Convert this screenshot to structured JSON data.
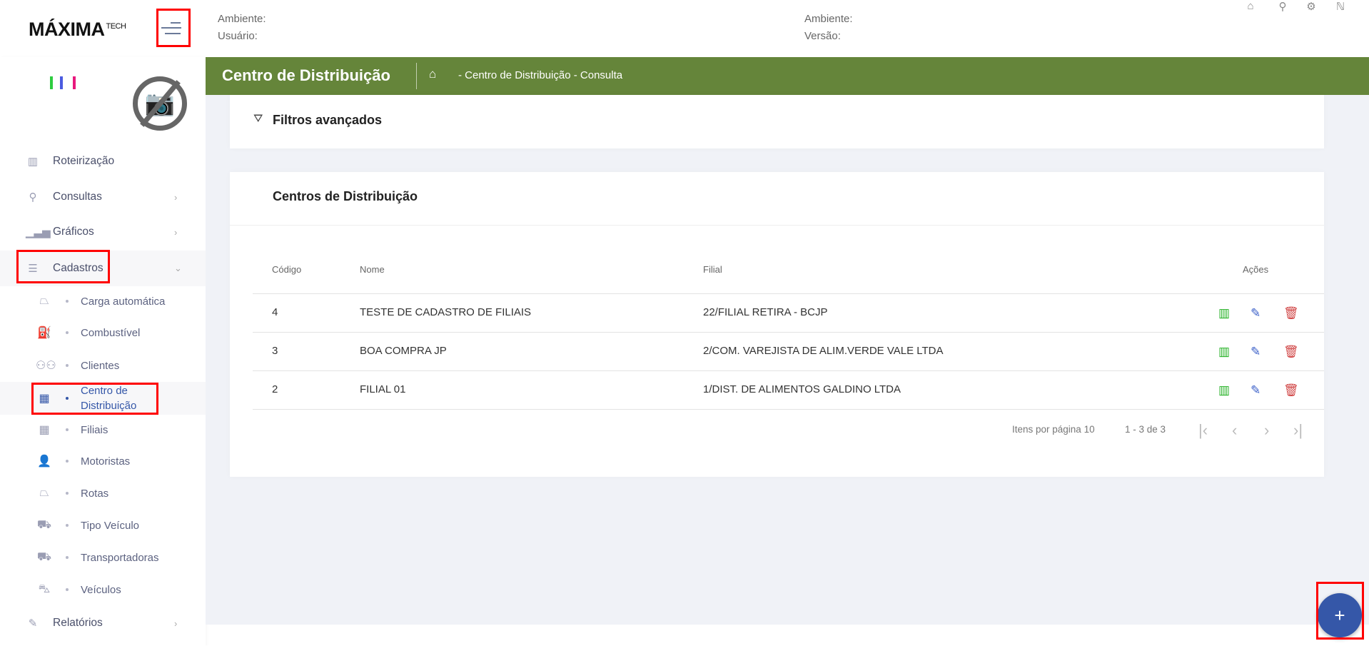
{
  "header": {
    "logo": "MÁXIMA",
    "logo_suffix": "TECH",
    "left_env_label": "Ambiente:",
    "user_label": "Usuário:",
    "right_env_label": "Ambiente:",
    "version_label": "Versão:",
    "icons": [
      "home-icon",
      "wrench-icon",
      "gear-icon",
      "info-icon"
    ]
  },
  "sidebar": {
    "items": [
      {
        "label": "Roteirização",
        "icon": "map-icon"
      },
      {
        "label": "Consultas",
        "icon": "search-icon"
      },
      {
        "label": "Gráficos",
        "icon": "bar-chart-icon"
      },
      {
        "label": "Cadastros",
        "icon": "sliders-icon"
      }
    ],
    "subitems": [
      {
        "label": "Carga automática"
      },
      {
        "label": "Combustível"
      },
      {
        "label": "Clientes"
      },
      {
        "label": "Centro de Distribuição"
      },
      {
        "label": "Filiais"
      },
      {
        "label": "Motoristas"
      },
      {
        "label": "Rotas"
      },
      {
        "label": "Tipo Veículo"
      },
      {
        "label": "Transportadoras"
      },
      {
        "label": "Veículos"
      }
    ],
    "reports": {
      "label": "Relatórios"
    }
  },
  "page": {
    "title": "Centro de Distribuição",
    "breadcrumb": "- Centro de Distribuição - Consulta",
    "filters_label": "Filtros avançados"
  },
  "table": {
    "title": "Centros de Distribuição",
    "columns": [
      "Código",
      "Nome",
      "Filial",
      "Ações"
    ],
    "rows": [
      {
        "code": "4",
        "name": "TESTE DE CADASTRO DE FILIAIS",
        "branch": "22/FILIAL RETIRA - BCJP"
      },
      {
        "code": "3",
        "name": "BOA COMPRA JP",
        "branch": "2/COM. VAREJISTA DE ALIM.VERDE VALE LTDA"
      },
      {
        "code": "2",
        "name": "FILIAL 01",
        "branch": "1/DIST. DE ALIMENTOS GALDINO LTDA"
      }
    ],
    "pagination": {
      "items_per_page_label": "Itens por página",
      "items_per_page": "10",
      "range": "1 - 3 de 3"
    }
  },
  "fab": {
    "label": "+"
  },
  "colors": {
    "green": "#65853a",
    "blue": "#3557a8",
    "map": "#22b022",
    "edit": "#3a5fc8",
    "delete": "#d04444"
  }
}
